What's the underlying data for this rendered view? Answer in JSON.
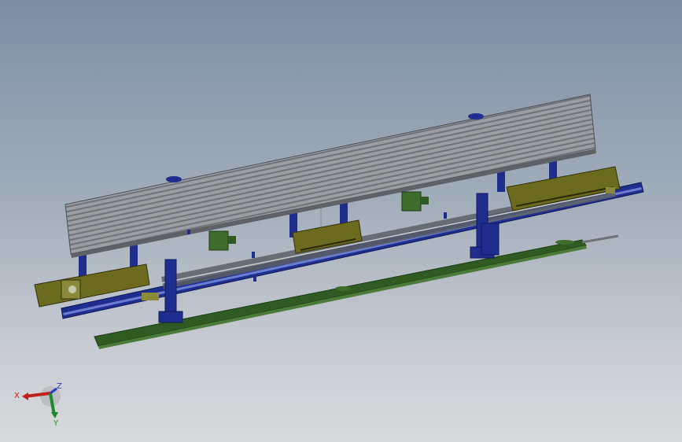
{
  "viewport": {
    "background_top": "#7d8ea4",
    "background_bottom": "#d8dadc"
  },
  "colors": {
    "frame_blue": "#1f2d8f",
    "carriage_olive": "#6b6a1e",
    "plate_green": "#2f5a22",
    "roller_gray": "#8f9296",
    "rail_gray": "#5b6066",
    "motor_green": "#3f6b2d"
  },
  "triad": {
    "x_label": "X",
    "y_label": "Y",
    "z_label": "Z",
    "x_color": "#c0211b",
    "y_color": "#1f8a2a",
    "z_color": "#2a3fc8"
  }
}
